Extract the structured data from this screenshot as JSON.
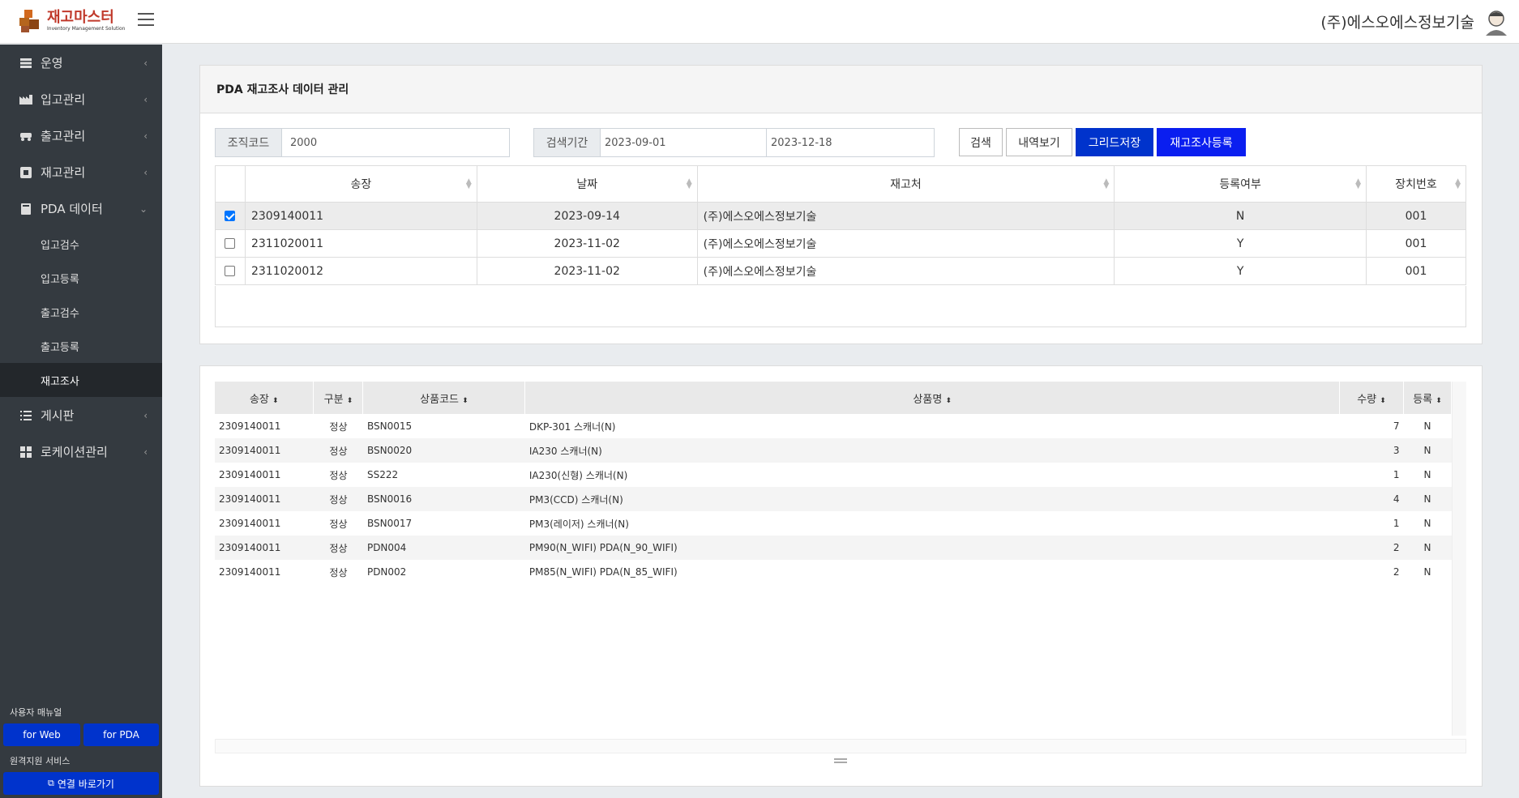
{
  "header": {
    "logo_title": "재고마스터",
    "logo_subtitle": "Inventory Management Solution",
    "company": "(주)에스오에스정보기술"
  },
  "sidebar": {
    "items": [
      {
        "label": "운영",
        "icon": "server-icon"
      },
      {
        "label": "입고관리",
        "icon": "factory-icon"
      },
      {
        "label": "출고관리",
        "icon": "truck-icon"
      },
      {
        "label": "재고관리",
        "icon": "box-icon"
      },
      {
        "label": "PDA 데이터",
        "icon": "device-icon"
      },
      {
        "label": "게시판",
        "icon": "list-icon"
      },
      {
        "label": "로케이션관리",
        "icon": "grid-icon"
      }
    ],
    "subitems": [
      "입고검수",
      "입고등록",
      "출고검수",
      "출고등록",
      "재고조사"
    ],
    "active_sub": "재고조사",
    "manual_label": "사용자 매뉴얼",
    "for_web": "for Web",
    "for_pda": "for PDA",
    "remote_label": "원격지원 서비스",
    "remote_button": "연결 바로가기"
  },
  "panel1": {
    "title": "PDA 재고조사 데이터 관리",
    "org_label": "조직코드",
    "org_value": "2000",
    "period_label": "검색기간",
    "date_from": "2023-09-01",
    "date_to": "2023-12-18",
    "btn_search": "검색",
    "btn_history": "내역보기",
    "btn_grid_save": "그리드저장",
    "btn_register": "재고조사등록",
    "columns": [
      "송장",
      "날짜",
      "재고처",
      "등록여부",
      "장치번호"
    ],
    "rows": [
      {
        "checked": true,
        "invoice": "2309140011",
        "date": "2023-09-14",
        "store": "(주)에스오에스정보기술",
        "registered": "N",
        "device": "001"
      },
      {
        "checked": false,
        "invoice": "2311020011",
        "date": "2023-11-02",
        "store": "(주)에스오에스정보기술",
        "registered": "Y",
        "device": "001"
      },
      {
        "checked": false,
        "invoice": "2311020012",
        "date": "2023-11-02",
        "store": "(주)에스오에스정보기술",
        "registered": "Y",
        "device": "001"
      }
    ]
  },
  "panel2": {
    "columns": [
      "송장",
      "구분",
      "상품코드",
      "상품명",
      "수량",
      "등록"
    ],
    "rows": [
      {
        "invoice": "2309140011",
        "type": "정상",
        "code": "BSN0015",
        "name": "DKP-301 스캐너(N)",
        "qty": "7",
        "reg": "N"
      },
      {
        "invoice": "2309140011",
        "type": "정상",
        "code": "BSN0020",
        "name": "IA230 스캐너(N)",
        "qty": "3",
        "reg": "N"
      },
      {
        "invoice": "2309140011",
        "type": "정상",
        "code": "SS222",
        "name": "IA230(신형) 스캐너(N)",
        "qty": "1",
        "reg": "N"
      },
      {
        "invoice": "2309140011",
        "type": "정상",
        "code": "BSN0016",
        "name": "PM3(CCD) 스캐너(N)",
        "qty": "4",
        "reg": "N"
      },
      {
        "invoice": "2309140011",
        "type": "정상",
        "code": "BSN0017",
        "name": "PM3(레이저) 스캐너(N)",
        "qty": "1",
        "reg": "N"
      },
      {
        "invoice": "2309140011",
        "type": "정상",
        "code": "PDN004",
        "name": "PM90(N_WIFI) PDA(N_90_WIFI)",
        "qty": "2",
        "reg": "N"
      },
      {
        "invoice": "2309140011",
        "type": "정상",
        "code": "PDN002",
        "name": "PM85(N_WIFI) PDA(N_85_WIFI)",
        "qty": "2",
        "reg": "N"
      }
    ]
  }
}
